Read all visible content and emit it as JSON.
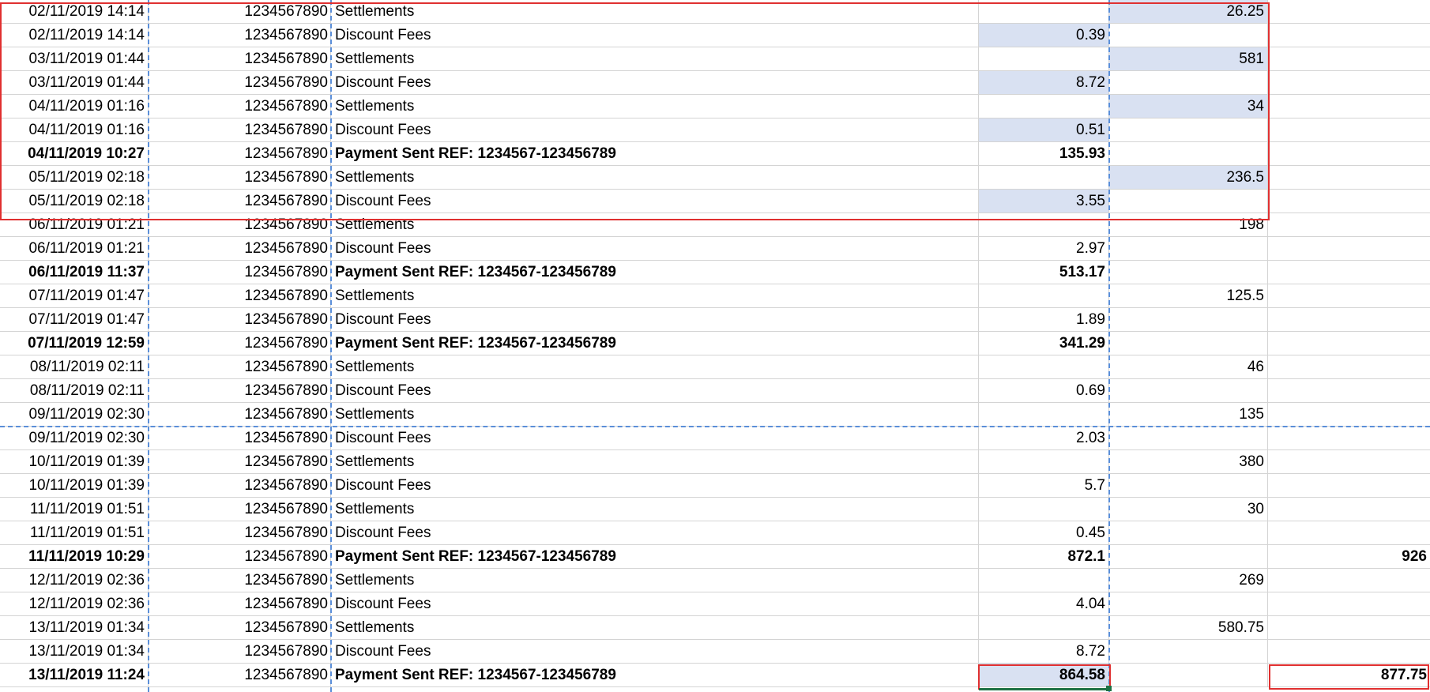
{
  "rows": [
    {
      "date": "02/11/2019 14:14",
      "account": "1234567890",
      "desc": "Settlements",
      "debit": "",
      "credit": "26.25",
      "total": "",
      "bold": false,
      "hl_debit": false,
      "hl_credit": true
    },
    {
      "date": "02/11/2019 14:14",
      "account": "1234567890",
      "desc": "Discount Fees",
      "debit": "0.39",
      "credit": "",
      "total": "",
      "bold": false,
      "hl_debit": true,
      "hl_credit": false
    },
    {
      "date": "03/11/2019 01:44",
      "account": "1234567890",
      "desc": "Settlements",
      "debit": "",
      "credit": "581",
      "total": "",
      "bold": false,
      "hl_debit": false,
      "hl_credit": true
    },
    {
      "date": "03/11/2019 01:44",
      "account": "1234567890",
      "desc": "Discount Fees",
      "debit": "8.72",
      "credit": "",
      "total": "",
      "bold": false,
      "hl_debit": true,
      "hl_credit": false
    },
    {
      "date": "04/11/2019 01:16",
      "account": "1234567890",
      "desc": "Settlements",
      "debit": "",
      "credit": "34",
      "total": "",
      "bold": false,
      "hl_debit": false,
      "hl_credit": true
    },
    {
      "date": "04/11/2019 01:16",
      "account": "1234567890",
      "desc": "Discount Fees",
      "debit": "0.51",
      "credit": "",
      "total": "",
      "bold": false,
      "hl_debit": true,
      "hl_credit": false
    },
    {
      "date": "04/11/2019 10:27",
      "account": "1234567890",
      "desc": "Payment Sent REF: 1234567-123456789",
      "debit": "135.93",
      "credit": "",
      "total": "",
      "bold": true,
      "hl_debit": false,
      "hl_credit": false
    },
    {
      "date": "05/11/2019 02:18",
      "account": "1234567890",
      "desc": "Settlements",
      "debit": "",
      "credit": "236.5",
      "total": "",
      "bold": false,
      "hl_debit": false,
      "hl_credit": true
    },
    {
      "date": "05/11/2019 02:18",
      "account": "1234567890",
      "desc": "Discount Fees",
      "debit": "3.55",
      "credit": "",
      "total": "",
      "bold": false,
      "hl_debit": true,
      "hl_credit": false
    },
    {
      "date": "06/11/2019 01:21",
      "account": "1234567890",
      "desc": "Settlements",
      "debit": "",
      "credit": "198",
      "total": "",
      "bold": false,
      "hl_debit": false,
      "hl_credit": false
    },
    {
      "date": "06/11/2019 01:21",
      "account": "1234567890",
      "desc": "Discount Fees",
      "debit": "2.97",
      "credit": "",
      "total": "",
      "bold": false,
      "hl_debit": false,
      "hl_credit": false
    },
    {
      "date": "06/11/2019 11:37",
      "account": "1234567890",
      "desc": "Payment Sent REF: 1234567-123456789",
      "debit": "513.17",
      "credit": "",
      "total": "",
      "bold": true,
      "hl_debit": false,
      "hl_credit": false
    },
    {
      "date": "07/11/2019 01:47",
      "account": "1234567890",
      "desc": "Settlements",
      "debit": "",
      "credit": "125.5",
      "total": "",
      "bold": false,
      "hl_debit": false,
      "hl_credit": false
    },
    {
      "date": "07/11/2019 01:47",
      "account": "1234567890",
      "desc": "Discount Fees",
      "debit": "1.89",
      "credit": "",
      "total": "",
      "bold": false,
      "hl_debit": false,
      "hl_credit": false
    },
    {
      "date": "07/11/2019 12:59",
      "account": "1234567890",
      "desc": "Payment Sent REF: 1234567-123456789",
      "debit": "341.29",
      "credit": "",
      "total": "",
      "bold": true,
      "hl_debit": false,
      "hl_credit": false
    },
    {
      "date": "08/11/2019 02:11",
      "account": "1234567890",
      "desc": "Settlements",
      "debit": "",
      "credit": "46",
      "total": "",
      "bold": false,
      "hl_debit": false,
      "hl_credit": false
    },
    {
      "date": "08/11/2019 02:11",
      "account": "1234567890",
      "desc": "Discount Fees",
      "debit": "0.69",
      "credit": "",
      "total": "",
      "bold": false,
      "hl_debit": false,
      "hl_credit": false
    },
    {
      "date": "09/11/2019 02:30",
      "account": "1234567890",
      "desc": "Settlements",
      "debit": "",
      "credit": "135",
      "total": "",
      "bold": false,
      "hl_debit": false,
      "hl_credit": false
    },
    {
      "date": "09/11/2019 02:30",
      "account": "1234567890",
      "desc": "Discount Fees",
      "debit": "2.03",
      "credit": "",
      "total": "",
      "bold": false,
      "hl_debit": false,
      "hl_credit": false
    },
    {
      "date": "10/11/2019 01:39",
      "account": "1234567890",
      "desc": "Settlements",
      "debit": "",
      "credit": "380",
      "total": "",
      "bold": false,
      "hl_debit": false,
      "hl_credit": false
    },
    {
      "date": "10/11/2019 01:39",
      "account": "1234567890",
      "desc": "Discount Fees",
      "debit": "5.7",
      "credit": "",
      "total": "",
      "bold": false,
      "hl_debit": false,
      "hl_credit": false
    },
    {
      "date": "11/11/2019 01:51",
      "account": "1234567890",
      "desc": "Settlements",
      "debit": "",
      "credit": "30",
      "total": "",
      "bold": false,
      "hl_debit": false,
      "hl_credit": false
    },
    {
      "date": "11/11/2019 01:51",
      "account": "1234567890",
      "desc": "Discount Fees",
      "debit": "0.45",
      "credit": "",
      "total": "",
      "bold": false,
      "hl_debit": false,
      "hl_credit": false
    },
    {
      "date": "11/11/2019 10:29",
      "account": "1234567890",
      "desc": "Payment Sent REF: 1234567-123456789",
      "debit": "872.1",
      "credit": "",
      "total": "926",
      "bold": true,
      "hl_debit": false,
      "hl_credit": false
    },
    {
      "date": "12/11/2019 02:36",
      "account": "1234567890",
      "desc": "Settlements",
      "debit": "",
      "credit": "269",
      "total": "",
      "bold": false,
      "hl_debit": false,
      "hl_credit": false
    },
    {
      "date": "12/11/2019 02:36",
      "account": "1234567890",
      "desc": "Discount Fees",
      "debit": "4.04",
      "credit": "",
      "total": "",
      "bold": false,
      "hl_debit": false,
      "hl_credit": false
    },
    {
      "date": "13/11/2019 01:34",
      "account": "1234567890",
      "desc": "Settlements",
      "debit": "",
      "credit": "580.75",
      "total": "",
      "bold": false,
      "hl_debit": false,
      "hl_credit": false
    },
    {
      "date": "13/11/2019 01:34",
      "account": "1234567890",
      "desc": "Discount Fees",
      "debit": "8.72",
      "credit": "",
      "total": "",
      "bold": false,
      "hl_debit": false,
      "hl_credit": false
    },
    {
      "date": "13/11/2019 11:24",
      "account": "1234567890",
      "desc": "Payment Sent REF: 1234567-123456789",
      "debit": "864.58",
      "credit": "",
      "total": "877.75",
      "bold": true,
      "hl_debit": true,
      "hl_credit": false
    }
  ],
  "colors": {
    "highlight": "#d9e1f2",
    "grid": "#d4d4d4",
    "page_break": "#5b8fd9",
    "annotation": "#e03030",
    "active_cell": "#1e7145"
  }
}
